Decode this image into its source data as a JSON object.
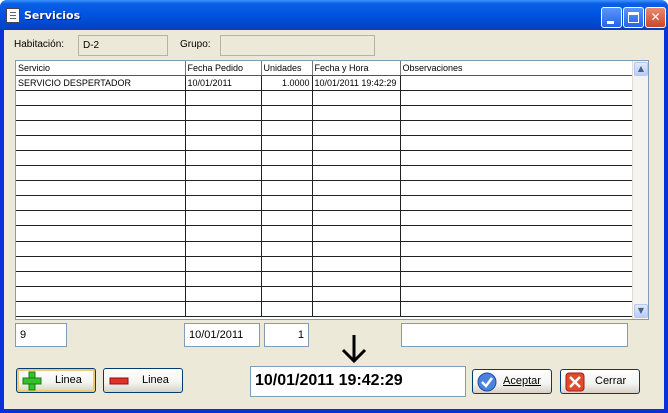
{
  "window": {
    "title": "Servicios"
  },
  "header": {
    "habitacion_label": "Habitación:",
    "habitacion_value": "D-2",
    "grupo_label": "Grupo:",
    "grupo_value": ""
  },
  "grid": {
    "columns": [
      "Servicio",
      "Fecha Pedido",
      "Unidades",
      "Fecha y Hora",
      "Observaciones"
    ],
    "rows": [
      [
        "SERVICIO DESPERTADOR",
        "10/01/2011",
        "1.0000",
        "10/01/2011 19:42:29",
        ""
      ],
      [
        "",
        "",
        "",
        "",
        ""
      ],
      [
        "",
        "",
        "",
        "",
        ""
      ],
      [
        "",
        "",
        "",
        "",
        ""
      ],
      [
        "",
        "",
        "",
        "",
        ""
      ],
      [
        "",
        "",
        "",
        "",
        ""
      ],
      [
        "",
        "",
        "",
        "",
        ""
      ],
      [
        "",
        "",
        "",
        "",
        ""
      ],
      [
        "",
        "",
        "",
        "",
        ""
      ],
      [
        "",
        "",
        "",
        "",
        ""
      ],
      [
        "",
        "",
        "",
        "",
        ""
      ],
      [
        "",
        "",
        "",
        "",
        ""
      ],
      [
        "",
        "",
        "",
        "",
        ""
      ],
      [
        "",
        "",
        "",
        "",
        ""
      ],
      [
        "",
        "",
        "",
        "",
        ""
      ],
      [
        "",
        "",
        "",
        "",
        ""
      ]
    ]
  },
  "edit_row": {
    "servicio_code": "9",
    "fecha_pedido": "10/01/2011",
    "unidades": "1",
    "observaciones": ""
  },
  "datetime_value": "10/01/2011 19:42:29",
  "buttons": {
    "add_line": "Linea",
    "remove_line": "Linea",
    "accept": "Aceptar",
    "close": "Cerrar"
  },
  "icons": {
    "app": "document-icon",
    "add": "green-plus-icon",
    "remove": "red-minus-icon",
    "accept": "blue-check-icon",
    "close": "red-x-icon",
    "arrow": "down-arrow-icon"
  }
}
